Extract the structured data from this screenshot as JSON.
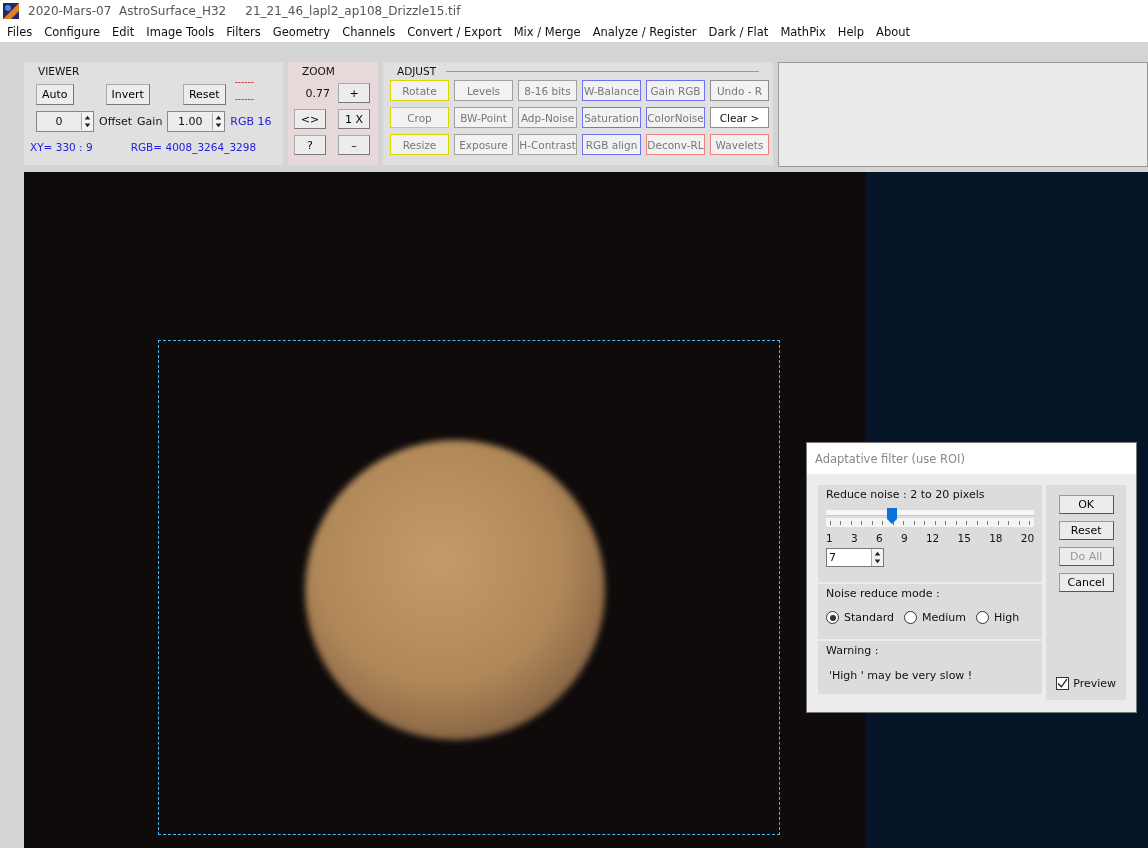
{
  "window": {
    "title": "2020-Mars-07  AstroSurface_H32     21_21_46_lapl2_ap108_Drizzle15.tif"
  },
  "menu": [
    "Files",
    "Configure",
    "Edit",
    "Image Tools",
    "Filters",
    "Geometry",
    "Channels",
    "Convert / Export",
    "Mix / Merge",
    "Analyze / Register",
    "Dark / Flat",
    "MathPix",
    "Help",
    "About"
  ],
  "viewer": {
    "title": "VIEWER",
    "buttons": [
      "Auto",
      "Invert",
      "Reset"
    ],
    "dashes": [
      "------",
      "------"
    ],
    "offset": {
      "value": "0",
      "label": "Offset"
    },
    "gain": {
      "label": "Gain",
      "value": "1.00"
    },
    "depth": "RGB 16",
    "xy": "XY=  330 : 9",
    "rgb": "RGB=  4008_3264_3298"
  },
  "zoom": {
    "title": "ZOOM",
    "value": "0.77",
    "buttons": [
      "+",
      "<>",
      "1 X",
      "?",
      "–"
    ]
  },
  "adjust": {
    "title": "ADJUST",
    "buttons": [
      {
        "label": "Rotate",
        "kind": "geometry",
        "disabled": true
      },
      {
        "label": "Levels",
        "kind": "tone",
        "disabled": true
      },
      {
        "label": "8-16 bits",
        "kind": "tone",
        "disabled": true
      },
      {
        "label": "W-Balance",
        "kind": "color",
        "disabled": true
      },
      {
        "label": "Gain RGB",
        "kind": "color",
        "disabled": true
      },
      {
        "label": "Undo - R",
        "kind": "history",
        "disabled": true
      },
      {
        "label": "Crop",
        "kind": "geometry",
        "disabled": true
      },
      {
        "label": "BW-Point",
        "kind": "tone",
        "disabled": true
      },
      {
        "label": "Adp-Noise",
        "kind": "tone",
        "disabled": true
      },
      {
        "label": "Saturation",
        "kind": "color",
        "disabled": true
      },
      {
        "label": "ColorNoise",
        "kind": "color",
        "disabled": true
      },
      {
        "label": "Clear >",
        "kind": "history",
        "disabled": false
      },
      {
        "label": "Resize",
        "kind": "geometry",
        "disabled": true
      },
      {
        "label": "Exposure",
        "kind": "tone",
        "disabled": true
      },
      {
        "label": "H-Contrast",
        "kind": "tone",
        "disabled": true
      },
      {
        "label": "RGB align",
        "kind": "color",
        "disabled": true
      },
      {
        "label": "Deconv-RL",
        "kind": "deconv",
        "disabled": true
      },
      {
        "label": "Wavelets",
        "kind": "deconv",
        "disabled": true
      }
    ]
  },
  "dialog": {
    "title": "Adaptative filter (use ROI)",
    "reduce_label": "Reduce noise :  2 to 20 pixels",
    "slider": {
      "level": 0.316
    },
    "scale": [
      "1",
      "3",
      "6",
      "9",
      "12",
      "15",
      "18",
      "20"
    ],
    "spin_value": "7",
    "mode_label": "Noise reduce mode :",
    "modes": [
      {
        "label": "Standard",
        "selected": true
      },
      {
        "label": "Medium",
        "selected": false
      },
      {
        "label": "High",
        "selected": false
      }
    ],
    "warning_label": "Warning :",
    "warning": "'High ' may be very slow !",
    "buttons": [
      {
        "label": "OK",
        "disabled": false
      },
      {
        "label": "Reset",
        "disabled": false
      },
      {
        "label": "Do All",
        "disabled": true
      },
      {
        "label": "Cancel",
        "disabled": false
      }
    ],
    "preview": {
      "label": "Preview",
      "checked": true
    }
  }
}
